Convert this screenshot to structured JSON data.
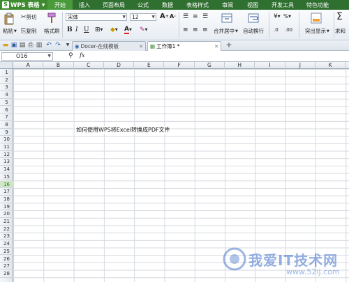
{
  "app": {
    "title": "WPS 表格",
    "logo": "S"
  },
  "menu": {
    "tabs": [
      {
        "label": "开始",
        "active": true
      },
      {
        "label": "插入",
        "active": false
      },
      {
        "label": "页面布局",
        "active": false
      },
      {
        "label": "公式",
        "active": false
      },
      {
        "label": "数据",
        "active": false
      },
      {
        "label": "表格样式",
        "active": false
      },
      {
        "label": "审阅",
        "active": false
      },
      {
        "label": "视图",
        "active": false
      },
      {
        "label": "开发工具",
        "active": false
      },
      {
        "label": "特色功能",
        "active": false
      }
    ]
  },
  "ribbon": {
    "paste": "粘贴",
    "cut": "剪切",
    "copy": "复制",
    "format_painter": "格式刷",
    "font_name": "宋体",
    "font_size": "12",
    "bold": "B",
    "italic": "I",
    "underline": "U",
    "merge_center": "合并居中",
    "wrap_text": "自动换行",
    "percent": "%",
    "highlight": "突出显示",
    "sum": "求和",
    "grow_font": "A",
    "shrink_font": "A"
  },
  "doc_tabs": [
    {
      "label": "Docer-在线模板",
      "active": false
    },
    {
      "label": "工作簿1 *",
      "active": true
    }
  ],
  "formula_bar": {
    "name_box": "O16",
    "fx": "fx"
  },
  "sheet": {
    "columns": [
      "A",
      "B",
      "C",
      "D",
      "E",
      "F",
      "G",
      "H",
      "I",
      "J",
      "K"
    ],
    "rows": [
      "1",
      "2",
      "3",
      "4",
      "5",
      "6",
      "7",
      "8",
      "9",
      "10",
      "11",
      "12",
      "13",
      "14",
      "15",
      "16",
      "17",
      "18",
      "19",
      "20",
      "21",
      "22",
      "23",
      "24",
      "25",
      "26",
      "27",
      "28"
    ],
    "selected_row": "16",
    "cell_b8": "如何使用WPS将Excel转换成PDF文件"
  },
  "watermark": {
    "text": "我爱IT技术网",
    "sub": "www.52ij.com"
  },
  "colors": {
    "menu_bg": "#2f6f2f",
    "accent": "#3e8b2f",
    "watermark": "#3c6ec8"
  }
}
